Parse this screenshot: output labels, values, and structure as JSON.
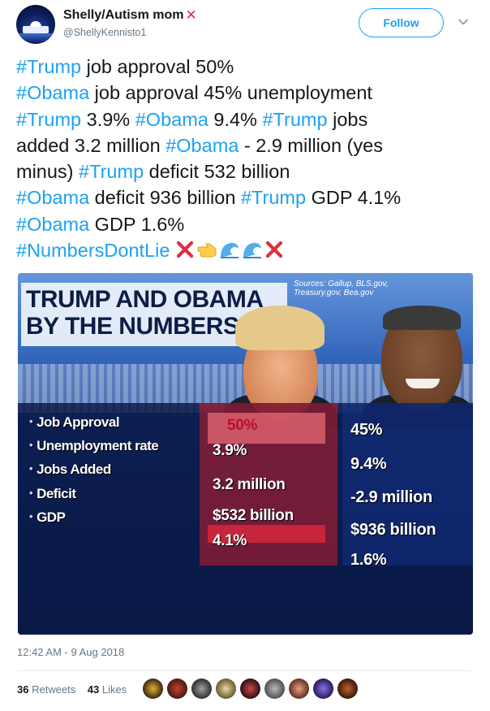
{
  "user": {
    "display_name": "Shelly/Autism mom",
    "name_emoji": "cross-mark",
    "handle": "@ShellyKennisto1",
    "follow_label": "Follow"
  },
  "tweet": {
    "segments": [
      {
        "t": "#Trump",
        "tag": true
      },
      {
        "t": " job approval 50%\n"
      },
      {
        "t": "#Obama",
        "tag": true
      },
      {
        "t": " job approval 45% unemployment\n"
      },
      {
        "t": "#Trump",
        "tag": true
      },
      {
        "t": " 3.9% "
      },
      {
        "t": "#Obama",
        "tag": true
      },
      {
        "t": " 9.4% "
      },
      {
        "t": "#Trump",
        "tag": true
      },
      {
        "t": " jobs\nadded 3.2 million "
      },
      {
        "t": "#Obama",
        "tag": true
      },
      {
        "t": " - 2.9 million (yes\nminus) "
      },
      {
        "t": "#Trump",
        "tag": true
      },
      {
        "t": " deficit 532 billion\n"
      },
      {
        "t": "#Obama",
        "tag": true
      },
      {
        "t": " deficit 936 billion "
      },
      {
        "t": "#Trump",
        "tag": true
      },
      {
        "t": " GDP 4.1%\n"
      },
      {
        "t": "#Obama",
        "tag": true
      },
      {
        "t": " GDP 1.6%\n"
      },
      {
        "t": "#NumbersDontLie",
        "tag": true
      },
      {
        "t": " "
      }
    ],
    "trailing_emojis": [
      "cross-mark",
      "pointing-hand",
      "water-wave",
      "water-wave",
      "cross-mark"
    ]
  },
  "media": {
    "title_line1": "TRUMP AND OBAMA",
    "title_line2": "BY THE NUMBERS",
    "sources": "Sources: Gallup, BLS.gov, Treasury.gov, Bea.gov",
    "rows": [
      {
        "label": "Job Approval",
        "trump": "50%",
        "obama": "45%"
      },
      {
        "label": "Unemployment rate",
        "trump": "3.9%",
        "obama": "9.4%"
      },
      {
        "label": "Jobs Added",
        "trump": "3.2 million",
        "obama": "-2.9 million"
      },
      {
        "label": "Deficit",
        "trump": "$532 billion",
        "obama": "$936 billion"
      },
      {
        "label": "GDP",
        "trump": "4.1%",
        "obama": "1.6%"
      }
    ]
  },
  "meta": {
    "timestamp": "12:42 AM - 9 Aug 2018",
    "retweets_count": "36",
    "retweets_label": "Retweets",
    "likes_count": "43",
    "likes_label": "Likes"
  },
  "colors": {
    "link": "#1da1f2",
    "text": "#14171a",
    "muted": "#657786"
  }
}
